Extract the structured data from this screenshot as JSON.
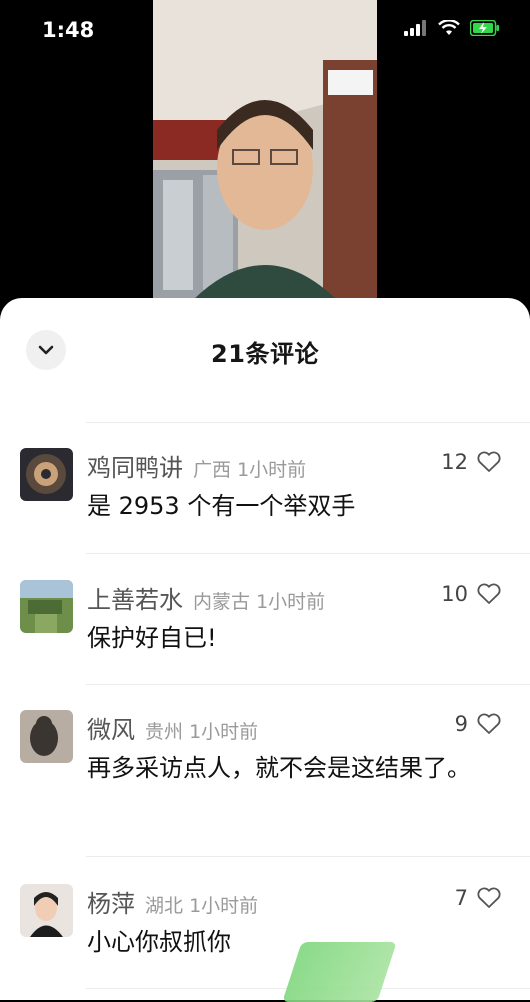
{
  "status_bar": {
    "time": "1:48"
  },
  "sheet": {
    "title": "21条评论"
  },
  "comments": [
    {
      "user": "鸡同鸭讲",
      "location": "广西",
      "time": "1小时前",
      "text": "是 2953 个有一个举双手",
      "likes": "12"
    },
    {
      "user": "上善若水",
      "location": "内蒙古",
      "time": "1小时前",
      "text": "保护好自已!",
      "likes": "10"
    },
    {
      "user": "微风",
      "location": "贵州",
      "time": "1小时前",
      "text": "再多采访点人，就不会是这结果了。",
      "likes": "9"
    },
    {
      "user": "杨萍",
      "location": "湖北",
      "time": "1小时前",
      "text": "小心你叔抓你",
      "likes": "7"
    }
  ],
  "colors": {
    "battery": "#32d74b",
    "sheet_bg": "#ffffff"
  },
  "icons": [
    "signal-icon",
    "wifi-icon",
    "battery-charging-icon",
    "chevron-down-icon",
    "heart-outline-icon"
  ]
}
